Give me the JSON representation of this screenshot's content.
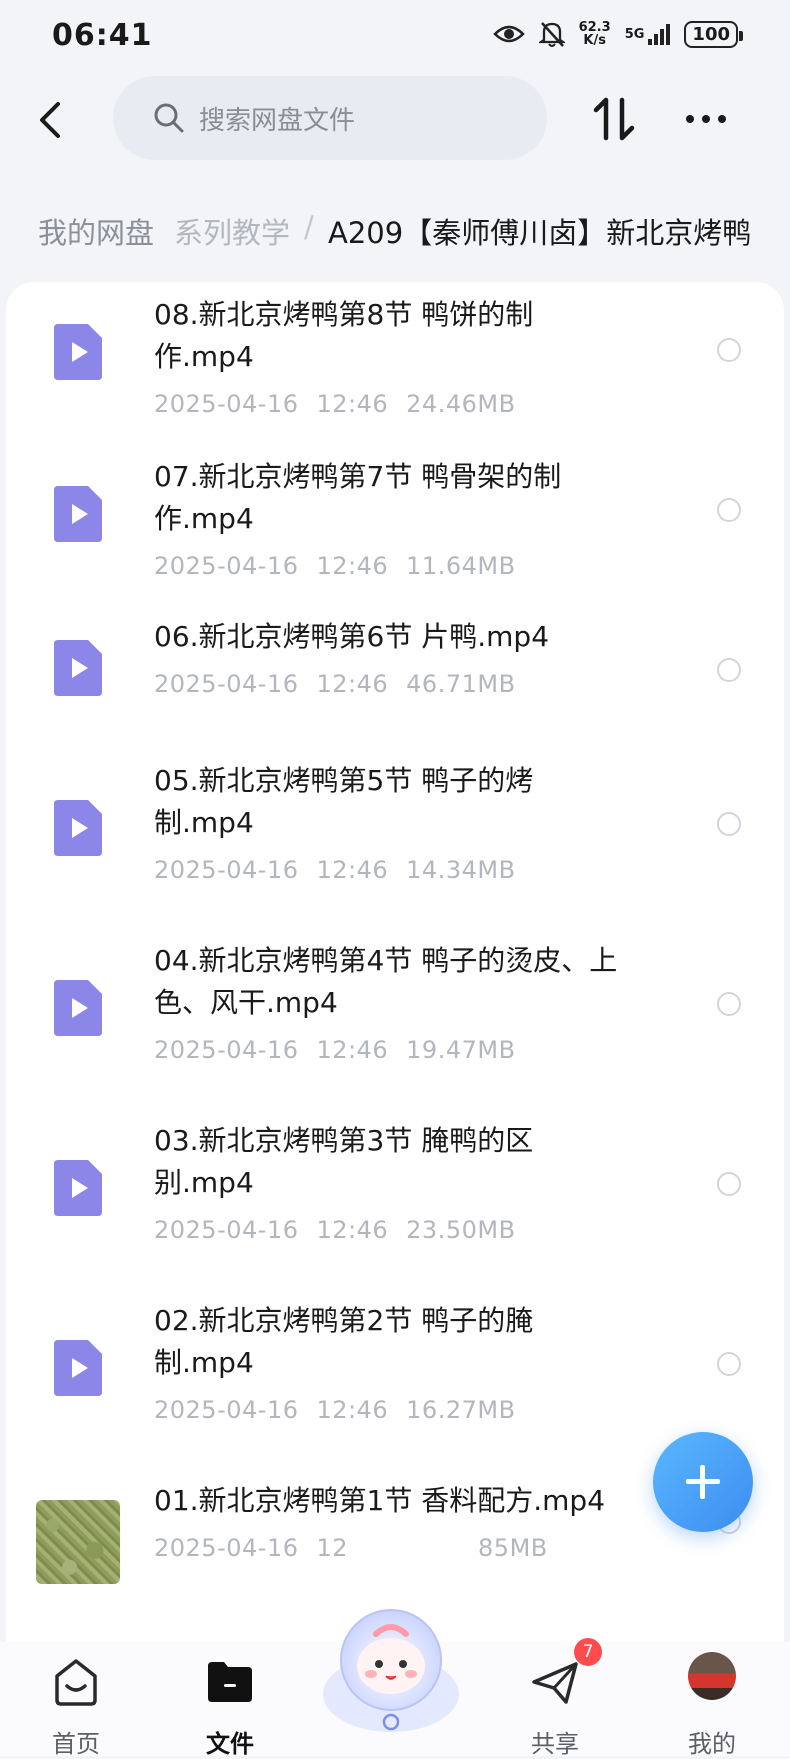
{
  "status_bar": {
    "time": "06:41",
    "net_speed_top": "62.3",
    "net_speed_bottom": "K/s",
    "signal": "5G",
    "battery": "100"
  },
  "top_bar": {
    "search_placeholder": "搜索网盘文件",
    "back_icon": "back-arrow-icon",
    "sort_icon": "sort-icon",
    "more_icon": "more-icon"
  },
  "breadcrumb": {
    "root": "我的网盘",
    "parent": "系列教学",
    "separator": "/",
    "current": "A209【秦师傅川卤】新北京烤鸭"
  },
  "files": [
    {
      "title_line1": "08.新北京烤鸭第8节 鸭饼的制",
      "title_line2": "作.mp4",
      "date": "2025-04-16",
      "time": "12:46",
      "size": "24.46MB"
    },
    {
      "title_line1": "07.新北京烤鸭第7节 鸭骨架的制",
      "title_line2": "作.mp4",
      "date": "2025-04-16",
      "time": "12:46",
      "size": "11.64MB"
    },
    {
      "title_line1": "06.新北京烤鸭第6节 片鸭.mp4",
      "title_line2": "",
      "date": "2025-04-16",
      "time": "12:46",
      "size": "46.71MB"
    },
    {
      "title_line1": "05.新北京烤鸭第5节 鸭子的烤",
      "title_line2": "制.mp4",
      "date": "2025-04-16",
      "time": "12:46",
      "size": "14.34MB"
    },
    {
      "title_line1": "04.新北京烤鸭第4节 鸭子的烫皮、上",
      "title_line2": "色、风干.mp4",
      "date": "2025-04-16",
      "time": "12:46",
      "size": "19.47MB"
    },
    {
      "title_line1": "03.新北京烤鸭第3节 腌鸭的区",
      "title_line2": "别.mp4",
      "date": "2025-04-16",
      "time": "12:46",
      "size": "23.50MB"
    },
    {
      "title_line1": "02.新北京烤鸭第2节 鸭子的腌",
      "title_line2": "制.mp4",
      "date": "2025-04-16",
      "time": "12:46",
      "size": "16.27MB"
    },
    {
      "title_line1": "01.新北京烤鸭第1节 香料配方.mp4",
      "title_line2": "",
      "date": "2025-04-16",
      "time": "12",
      "size": "85MB"
    }
  ],
  "nav": {
    "home": "首页",
    "files": "文件",
    "share": "共享",
    "mine": "我的",
    "share_badge": "7"
  },
  "colors": {
    "video_icon": "#8b86e8",
    "fab": "#3d8cf0",
    "badge": "#ff4d4f"
  }
}
